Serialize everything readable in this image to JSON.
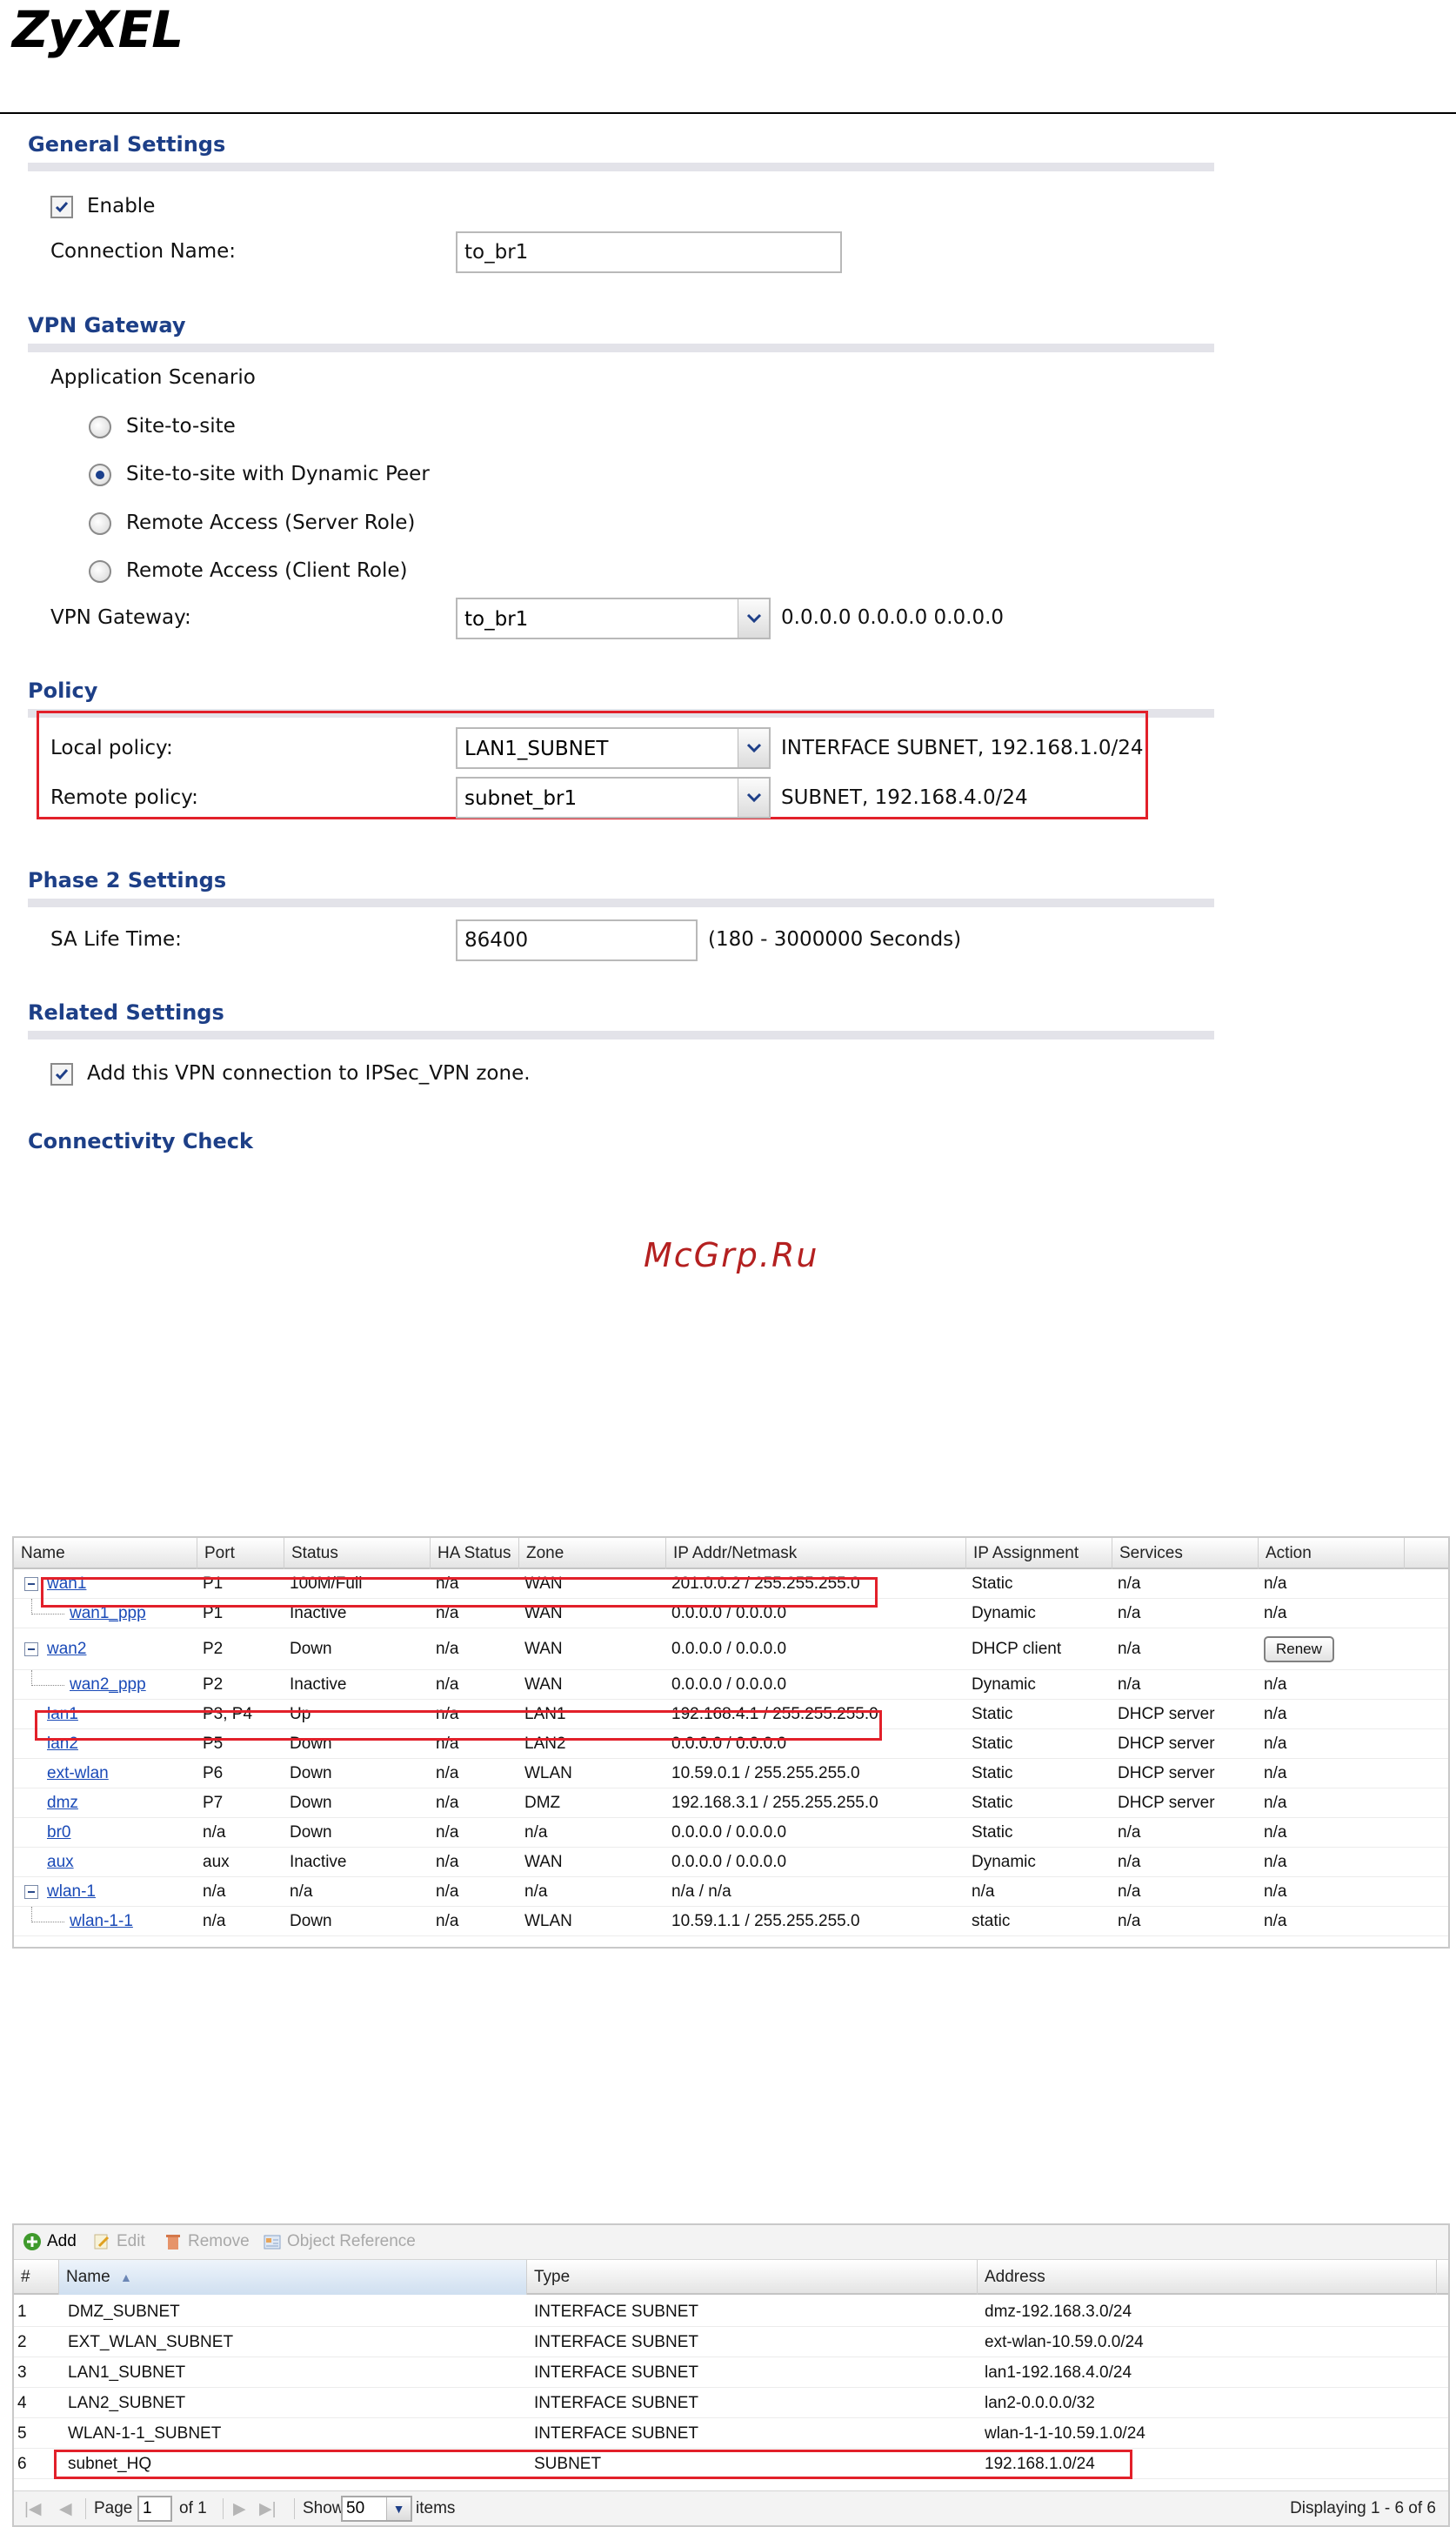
{
  "brand": {
    "logo": "ZyXEL"
  },
  "general": {
    "title": "General Settings",
    "enable_label": "Enable",
    "enable_checked": true,
    "connection_name_label": "Connection Name:",
    "connection_name_value": "to_br1"
  },
  "vpn_gateway": {
    "title": "VPN Gateway",
    "scenario_label": "Application Scenario",
    "scenarios": [
      "Site-to-site",
      "Site-to-site with Dynamic Peer",
      "Remote Access (Server Role)",
      "Remote Access (Client Role)"
    ],
    "selected_scenario": "Site-to-site with Dynamic Peer",
    "gateway_label": "VPN Gateway:",
    "gateway_value": "to_br1",
    "gateway_info": "0.0.0.0 0.0.0.0 0.0.0.0"
  },
  "policy": {
    "title": "Policy",
    "local_label": "Local policy:",
    "local_value": "LAN1_SUBNET",
    "local_info": "INTERFACE SUBNET, 192.168.1.0/24",
    "remote_label": "Remote policy:",
    "remote_value": "subnet_br1",
    "remote_info": "SUBNET, 192.168.4.0/24"
  },
  "phase2": {
    "title": "Phase 2 Settings",
    "sa_label": "SA Life Time:",
    "sa_value": "86400",
    "sa_hint": "(180 - 3000000 Seconds)"
  },
  "related": {
    "title": "Related Settings",
    "zone_label": "Add this VPN connection to IPSec_VPN zone.",
    "zone_checked": true
  },
  "connectivity": {
    "title": "Connectivity Check"
  },
  "watermark": "McGrp.Ru",
  "interfaces": {
    "columns": [
      "Name",
      "Port",
      "Status",
      "HA Status",
      "Zone",
      "IP Addr/Netmask",
      "IP Assignment",
      "Services",
      "Action"
    ],
    "rows": [
      {
        "name": "wan1",
        "port": "P1",
        "status": "100M/Full",
        "ha": "n/a",
        "zone": "WAN",
        "ip": "201.0.0.2 / 255.255.255.0",
        "assign": "Static",
        "services": "n/a",
        "action": "n/a"
      },
      {
        "name": "wan1_ppp",
        "port": "P1",
        "status": "Inactive",
        "ha": "n/a",
        "zone": "WAN",
        "ip": "0.0.0.0 / 0.0.0.0",
        "assign": "Dynamic",
        "services": "n/a",
        "action": "n/a"
      },
      {
        "name": "wan2",
        "port": "P2",
        "status": "Down",
        "ha": "n/a",
        "zone": "WAN",
        "ip": "0.0.0.0 / 0.0.0.0",
        "assign": "DHCP client",
        "services": "n/a",
        "action": "Renew"
      },
      {
        "name": "wan2_ppp",
        "port": "P2",
        "status": "Inactive",
        "ha": "n/a",
        "zone": "WAN",
        "ip": "0.0.0.0 / 0.0.0.0",
        "assign": "Dynamic",
        "services": "n/a",
        "action": "n/a"
      },
      {
        "name": "lan1",
        "port": "P3, P4",
        "status": "Up",
        "ha": "n/a",
        "zone": "LAN1",
        "ip": "192.168.4.1 / 255.255.255.0",
        "assign": "Static",
        "services": "DHCP server",
        "action": "n/a"
      },
      {
        "name": "lan2",
        "port": "P5",
        "status": "Down",
        "ha": "n/a",
        "zone": "LAN2",
        "ip": "0.0.0.0 / 0.0.0.0",
        "assign": "Static",
        "services": "DHCP server",
        "action": "n/a"
      },
      {
        "name": "ext-wlan",
        "port": "P6",
        "status": "Down",
        "ha": "n/a",
        "zone": "WLAN",
        "ip": "10.59.0.1 / 255.255.255.0",
        "assign": "Static",
        "services": "DHCP server",
        "action": "n/a"
      },
      {
        "name": "dmz",
        "port": "P7",
        "status": "Down",
        "ha": "n/a",
        "zone": "DMZ",
        "ip": "192.168.3.1 / 255.255.255.0",
        "assign": "Static",
        "services": "DHCP server",
        "action": "n/a"
      },
      {
        "name": "br0",
        "port": "n/a",
        "status": "Down",
        "ha": "n/a",
        "zone": "n/a",
        "ip": "0.0.0.0 / 0.0.0.0",
        "assign": "Static",
        "services": "n/a",
        "action": "n/a"
      },
      {
        "name": "aux",
        "port": "aux",
        "status": "Inactive",
        "ha": "n/a",
        "zone": "WAN",
        "ip": "0.0.0.0 / 0.0.0.0",
        "assign": "Dynamic",
        "services": "n/a",
        "action": "n/a"
      },
      {
        "name": "wlan-1",
        "port": "n/a",
        "status": "n/a",
        "ha": "n/a",
        "zone": "n/a",
        "ip": "n/a / n/a",
        "assign": "n/a",
        "services": "n/a",
        "action": "n/a"
      },
      {
        "name": "wlan-1-1",
        "port": "n/a",
        "status": "Down",
        "ha": "n/a",
        "zone": "WLAN",
        "ip": "10.59.1.1 / 255.255.255.0",
        "assign": "static",
        "services": "n/a",
        "action": "n/a"
      }
    ]
  },
  "objects": {
    "toolbar": {
      "add": "Add",
      "edit": "Edit",
      "remove": "Remove",
      "object_reference": "Object Reference"
    },
    "columns": [
      "#",
      "Name",
      "Type",
      "Address"
    ],
    "rows": [
      {
        "num": "1",
        "name": "DMZ_SUBNET",
        "type": "INTERFACE SUBNET",
        "address": "dmz-192.168.3.0/24"
      },
      {
        "num": "2",
        "name": "EXT_WLAN_SUBNET",
        "type": "INTERFACE SUBNET",
        "address": "ext-wlan-10.59.0.0/24"
      },
      {
        "num": "3",
        "name": "LAN1_SUBNET",
        "type": "INTERFACE SUBNET",
        "address": "lan1-192.168.4.0/24"
      },
      {
        "num": "4",
        "name": "LAN2_SUBNET",
        "type": "INTERFACE SUBNET",
        "address": "lan2-0.0.0.0/32"
      },
      {
        "num": "5",
        "name": "WLAN-1-1_SUBNET",
        "type": "INTERFACE SUBNET",
        "address": "wlan-1-1-10.59.1.0/24"
      },
      {
        "num": "6",
        "name": "subnet_HQ",
        "type": "SUBNET",
        "address": "192.168.1.0/24"
      }
    ],
    "pager": {
      "page_label": "Page",
      "page_value": "1",
      "of_label": "of 1",
      "show_label": "Show",
      "show_value": "50",
      "items_label": "items",
      "displaying": "Displaying 1 - 6 of 6"
    }
  },
  "colors": {
    "section_title": "#1d3f87",
    "link": "#1a4ab7",
    "highlight_box": "#e2202a"
  }
}
